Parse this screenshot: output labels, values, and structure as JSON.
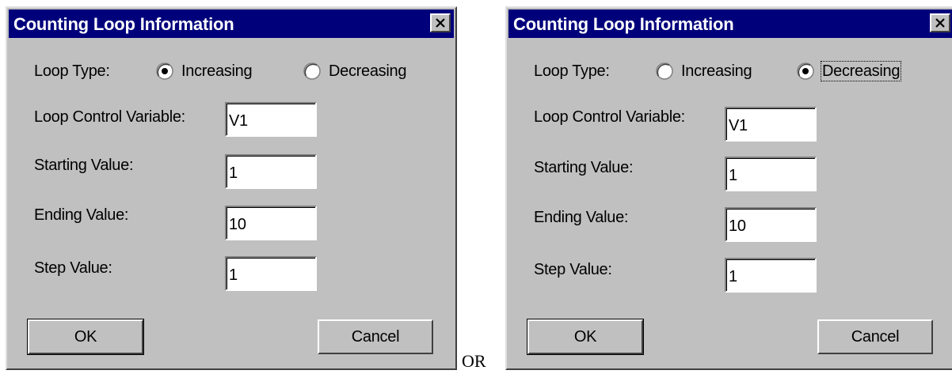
{
  "dialogs": [
    {
      "title": "Counting Loop Information",
      "loop_type_label": "Loop Type:",
      "options": [
        {
          "label": "Increasing",
          "selected": true
        },
        {
          "label": "Decreasing",
          "selected": false
        }
      ],
      "fields": [
        {
          "label": "Loop Control Variable:",
          "value": "V1"
        },
        {
          "label": "Starting Value:",
          "value": "1"
        },
        {
          "label": "Ending Value:",
          "value": "10"
        },
        {
          "label": "Step Value:",
          "value": "1"
        }
      ],
      "ok_label": "OK",
      "cancel_label": "Cancel"
    },
    {
      "title": "Counting Loop Information",
      "loop_type_label": "Loop Type:",
      "options": [
        {
          "label": "Increasing",
          "selected": false
        },
        {
          "label": "Decreasing",
          "selected": true
        }
      ],
      "fields": [
        {
          "label": "Loop Control Variable:",
          "value": "V1"
        },
        {
          "label": "Starting Value:",
          "value": "1"
        },
        {
          "label": "Ending Value:",
          "value": "10"
        },
        {
          "label": "Step Value:",
          "value": "1"
        }
      ],
      "ok_label": "OK",
      "cancel_label": "Cancel"
    }
  ],
  "separator_text": "OR",
  "colors": {
    "titlebar": "#00007b",
    "dialog_face": "#c0c0c0"
  }
}
